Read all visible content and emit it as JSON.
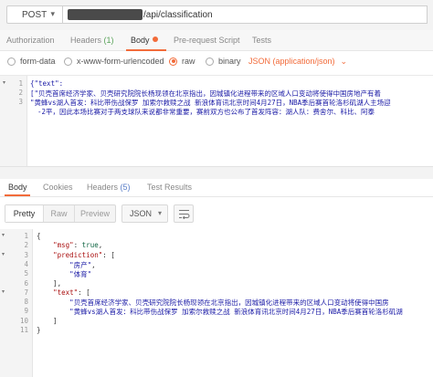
{
  "request": {
    "method": "POST",
    "url_suffix": "/api/classification"
  },
  "request_tabs": [
    {
      "label": "Authorization"
    },
    {
      "label": "Headers",
      "count": "(1)"
    },
    {
      "label": "Body",
      "active": true
    },
    {
      "label": "Pre-request Script"
    },
    {
      "label": "Tests"
    }
  ],
  "body_types": [
    {
      "label": "form-data"
    },
    {
      "label": "x-www-form-urlencoded"
    },
    {
      "label": "raw",
      "selected": true
    },
    {
      "label": "binary"
    }
  ],
  "content_type": "JSON (application/json)",
  "request_body": {
    "lines": [
      {
        "num": "1",
        "text": "{\"text\":"
      },
      {
        "num": "2",
        "text": "[\"贝壳首席经济学家、贝壳研究院院长杨现领在北京指出，因城镇化进程带来的区域人口变动将使得中国房地产有着",
        "text_wrap": ""
      },
      {
        "num": "3",
        "text": "\"黄蜂vs湖人首发：科比带伤战保罗 加索尔救赎之战 新浪体育讯北京时间4月27日，NBA季后赛首轮洛杉矶湖人主场迎",
        "text_wrap": "-2平，因此本场比赛对于两支球队来说都非常重要，赛前双方也公布了首发阵容：湖人队：费舍尔、科比、阿泰"
      }
    ]
  },
  "response_tabs": [
    {
      "label": "Body",
      "active": true
    },
    {
      "label": "Cookies"
    },
    {
      "label": "Headers",
      "count": "(5)"
    },
    {
      "label": "Test Results"
    }
  ],
  "view_modes": [
    "Pretty",
    "Raw",
    "Preview"
  ],
  "response_format": "JSON",
  "response_body": {
    "line_numbers": [
      "1",
      "2",
      "3",
      "4",
      "5",
      "6",
      "7",
      "8",
      "9",
      "10",
      "11"
    ],
    "lines": [
      "{",
      "    \"msg\": true,",
      "    \"prediction\": [",
      "        \"房产\",",
      "        \"体育\"",
      "    ],",
      "    \"text\": [",
      "        \"贝壳首席经济学家、贝壳研究院院长杨现领在北京指出，因城镇化进程带来的区域人口变动将使得中国房",
      "        \"黄蜂vs湖人首发：科比带伤战保罗 加索尔救赎之战 新浪体育讯北京时间4月27日，NBA季后赛首轮洛杉矶湖",
      "    ]",
      "}"
    ]
  },
  "colors": {
    "accent": "#f26b3a",
    "count_green": "#5aa35a",
    "count_blue": "#5a7fc8"
  }
}
